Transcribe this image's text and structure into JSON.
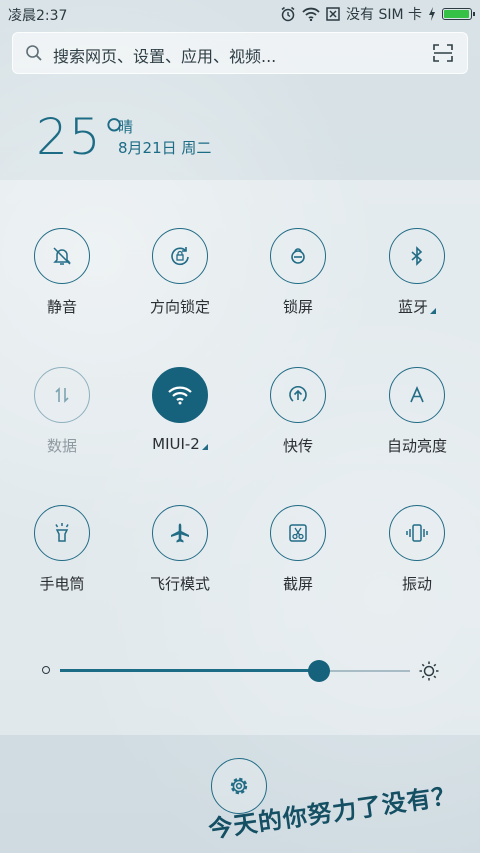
{
  "status_bar": {
    "time": "凌晨2:37",
    "carrier": "没有 SIM 卡",
    "battery_level": 1.0
  },
  "search": {
    "placeholder": "搜索网页、设置、应用、视频..."
  },
  "weather": {
    "temperature": "25°",
    "condition": "晴",
    "date": "8月21日 周二"
  },
  "quick_settings": [
    {
      "label": "静音",
      "icon": "silent-bell-icon",
      "state": "off"
    },
    {
      "label": "方向锁定",
      "icon": "rotation-lock-icon",
      "state": "off"
    },
    {
      "label": "锁屏",
      "icon": "lock-icon",
      "state": "off"
    },
    {
      "label": "蓝牙",
      "icon": "bluetooth-icon",
      "state": "off",
      "has_more": true
    },
    {
      "label": "数据",
      "icon": "mobile-data-icon",
      "state": "disabled"
    },
    {
      "label": "MIUI-2",
      "icon": "wifi-icon",
      "state": "on",
      "has_more": true
    },
    {
      "label": "快传",
      "icon": "quick-transfer-icon",
      "state": "off"
    },
    {
      "label": "自动亮度",
      "icon": "auto-brightness-icon",
      "state": "off"
    },
    {
      "label": "手电筒",
      "icon": "flashlight-icon",
      "state": "off"
    },
    {
      "label": "飞行模式",
      "icon": "airplane-icon",
      "state": "off"
    },
    {
      "label": "截屏",
      "icon": "screenshot-icon",
      "state": "off"
    },
    {
      "label": "振动",
      "icon": "vibrate-icon",
      "state": "off"
    }
  ],
  "brightness": {
    "level": 0.74
  },
  "footer": {
    "slogan": "今天的你努力了没有？"
  },
  "colors": {
    "accent": "#16627c",
    "battery": "#35c145"
  }
}
